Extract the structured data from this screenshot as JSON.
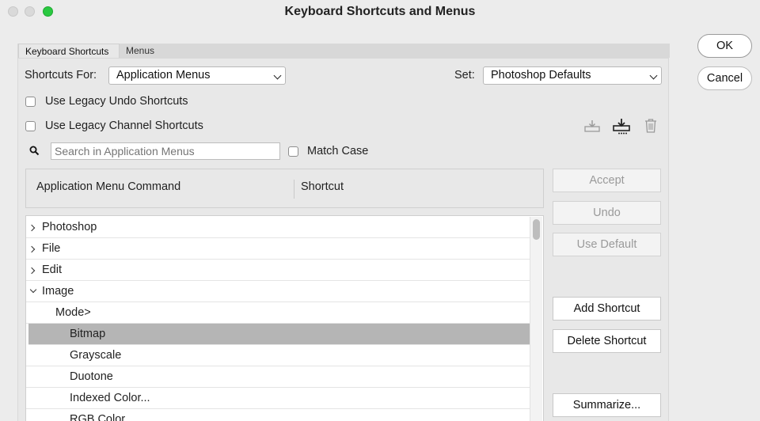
{
  "window": {
    "title": "Keyboard Shortcuts and Menus"
  },
  "tabs": [
    {
      "label": "Keyboard Shortcuts"
    },
    {
      "label": "Menus"
    }
  ],
  "shortcuts_for": {
    "label": "Shortcuts For:",
    "value": "Application Menus"
  },
  "set": {
    "label": "Set:",
    "value": "Photoshop Defaults"
  },
  "options": {
    "legacy_undo": "Use Legacy Undo Shortcuts",
    "legacy_channel": "Use Legacy Channel Shortcuts",
    "match_case": "Match Case"
  },
  "search": {
    "placeholder": "Search in Application Menus"
  },
  "columns": {
    "command": "Application Menu Command",
    "shortcut": "Shortcut"
  },
  "rows": [
    {
      "label": "Photoshop"
    },
    {
      "label": "File"
    },
    {
      "label": "Edit"
    },
    {
      "label": "Image"
    },
    {
      "label": "Mode>"
    },
    {
      "label": "Bitmap"
    },
    {
      "label": "Grayscale"
    },
    {
      "label": "Duotone"
    },
    {
      "label": "Indexed Color..."
    },
    {
      "label": "RGB Color"
    }
  ],
  "buttons": {
    "ok": "OK",
    "cancel": "Cancel",
    "accept": "Accept",
    "undo": "Undo",
    "use_default": "Use Default",
    "add_shortcut": "Add Shortcut",
    "delete_shortcut": "Delete Shortcut",
    "summarize": "Summarize..."
  },
  "icons": {
    "save": "save-set-icon",
    "save_as": "new-set-icon",
    "delete": "trash-icon",
    "search": "search-icon"
  }
}
